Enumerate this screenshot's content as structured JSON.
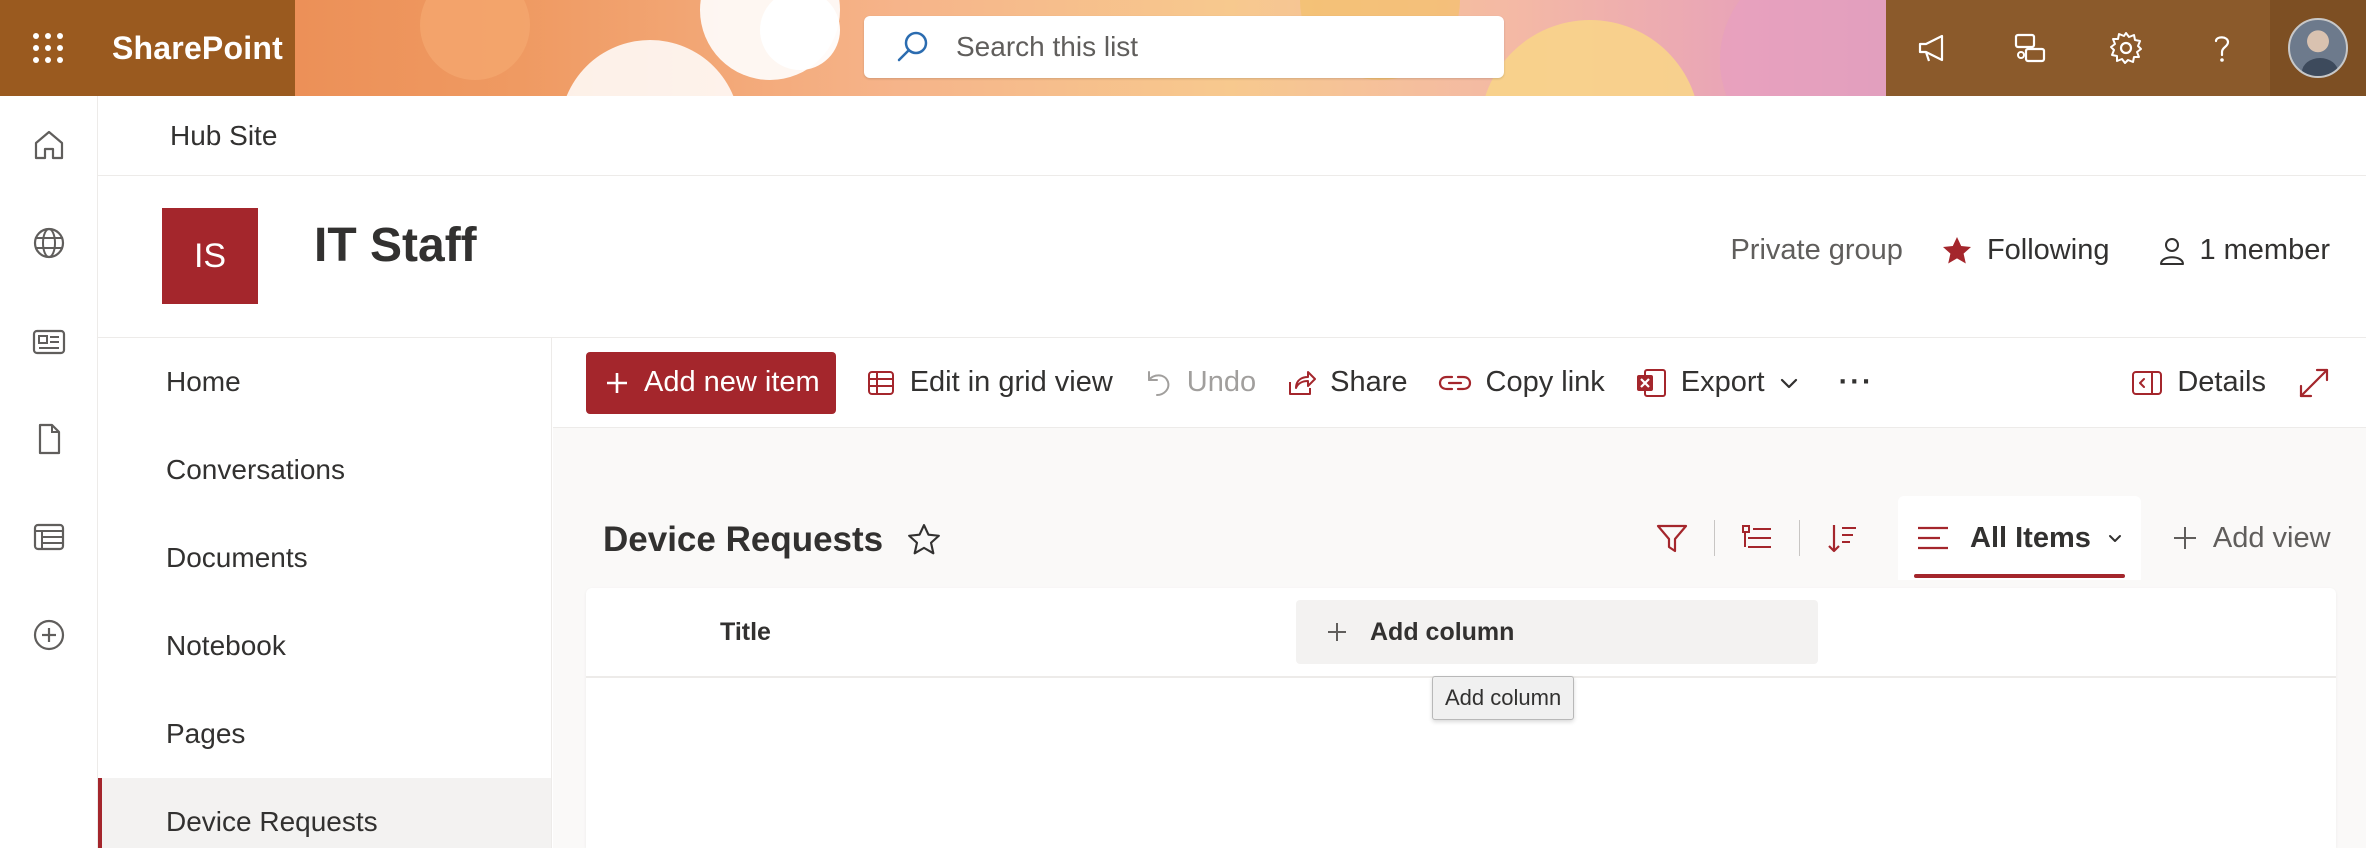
{
  "suite": {
    "brand": "SharePoint",
    "search_placeholder": "Search this list"
  },
  "hub": {
    "name": "Hub Site"
  },
  "site": {
    "logo_initials": "IS",
    "title": "IT Staff",
    "privacy": "Private group",
    "follow_label": "Following",
    "members_label": "1 member"
  },
  "nav": {
    "items": [
      {
        "label": "Home"
      },
      {
        "label": "Conversations"
      },
      {
        "label": "Documents"
      },
      {
        "label": "Notebook"
      },
      {
        "label": "Pages"
      },
      {
        "label": "Device Requests"
      }
    ],
    "selected": "Device Requests"
  },
  "commands": {
    "add_new_item": "Add new item",
    "edit_grid": "Edit in grid view",
    "undo": "Undo",
    "share": "Share",
    "copy_link": "Copy link",
    "export": "Export",
    "more": "···",
    "details": "Details"
  },
  "list": {
    "title": "Device Requests",
    "view_name": "All Items",
    "add_view": "Add view",
    "columns": [
      "Title"
    ],
    "add_column": "Add column",
    "tooltip": "Add column"
  },
  "colors": {
    "accent": "#a4262c",
    "suite_dark": "#9a5a1f",
    "text": "#323130"
  }
}
